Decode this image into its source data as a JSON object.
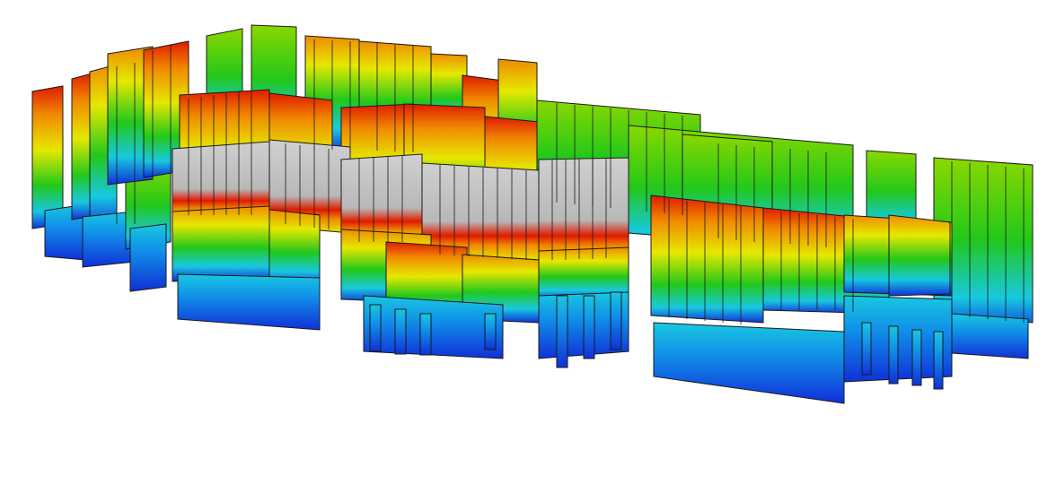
{
  "scene": {
    "background": "#ffffff",
    "content": "fea-stress-contour-3d-building-walls",
    "legend_visible": false
  },
  "contour_palette": {
    "blue": "#1030d8",
    "cyan": "#18c8e0",
    "green": "#22c81a",
    "yellow": "#e6e800",
    "orange": "#f08a00",
    "red": "#e01a00",
    "grey": "#bcbcbc",
    "edge": "#1a1a1a"
  }
}
